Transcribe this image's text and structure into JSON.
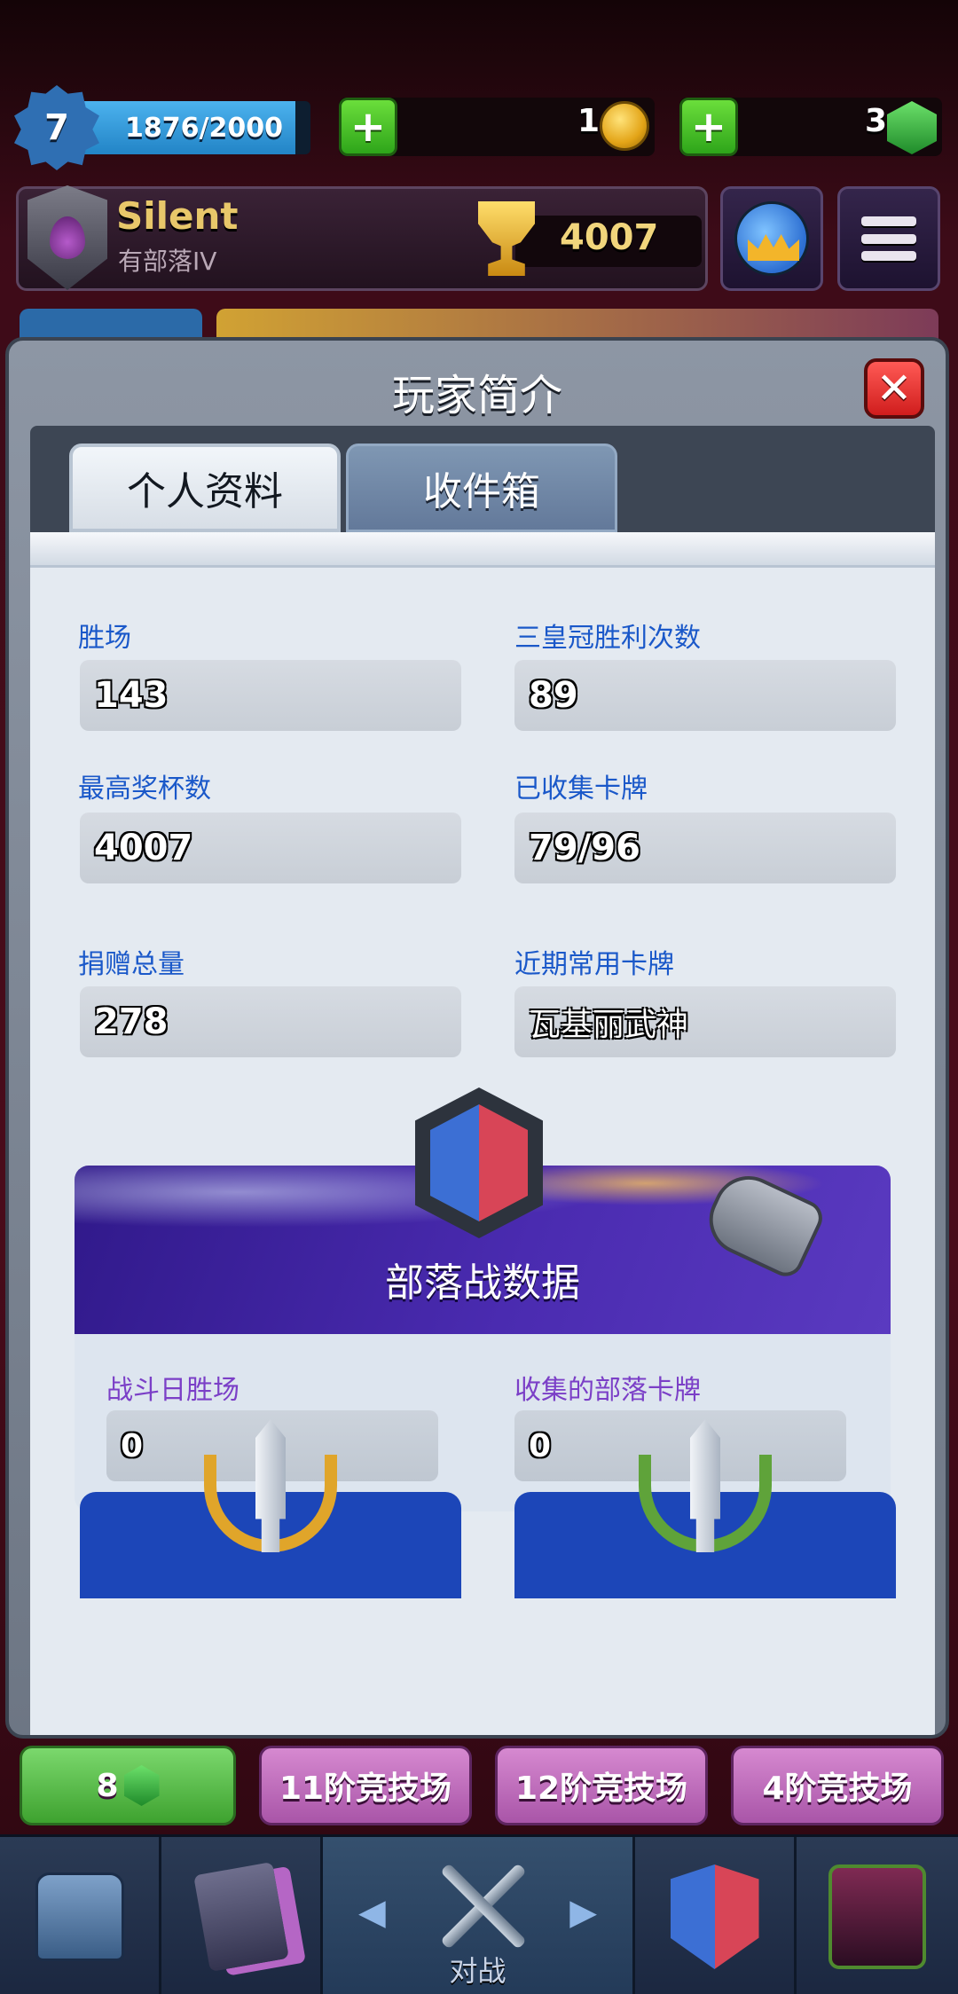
{
  "topbar": {
    "level": "7",
    "xp": "1876/2000",
    "xp_progress": 0.938,
    "gold": "1",
    "gems": "3",
    "gold_plus_icon": "plus-icon",
    "gems_plus_icon": "plus-icon"
  },
  "profile": {
    "name": "Silent",
    "clan": "有部落IV",
    "trophies": "4007"
  },
  "modal": {
    "title": "玩家简介",
    "close_icon": "close-icon",
    "tabs": [
      {
        "label": "个人资料",
        "active": true
      },
      {
        "label": "收件箱",
        "active": false
      }
    ]
  },
  "stats": {
    "wins": {
      "label": "胜场",
      "value": "143"
    },
    "three_crown": {
      "label": "三皇冠胜利次数",
      "value": "89"
    },
    "best_trophies": {
      "label": "最高奖杯数",
      "value": "4007"
    },
    "cards_found": {
      "label": "已收集卡牌",
      "value": "79/96"
    },
    "donations": {
      "label": "捐赠总量",
      "value": "278"
    },
    "favorite_card": {
      "label": "近期常用卡牌",
      "value": "瓦基丽武神"
    }
  },
  "clan_war": {
    "title": "部落战数据",
    "battle_day_wins": {
      "label": "战斗日胜场",
      "value": "0"
    },
    "collected_cards": {
      "label": "收集的部落卡牌",
      "value": "0"
    }
  },
  "lower_tabs": {
    "gems": "8",
    "arena_11": "11阶竞技场",
    "arena_12": "12阶竞技场",
    "arena_4": "4阶竞技场"
  },
  "bottom_nav": {
    "battle": "对战",
    "left_arrow": "◀",
    "right_arrow": "▶"
  },
  "colors": {
    "label_blue": "#1a58c9",
    "label_purple": "#7b3fc7",
    "clan_war_header": "#3a21a0",
    "close_red": "#e0302c"
  }
}
